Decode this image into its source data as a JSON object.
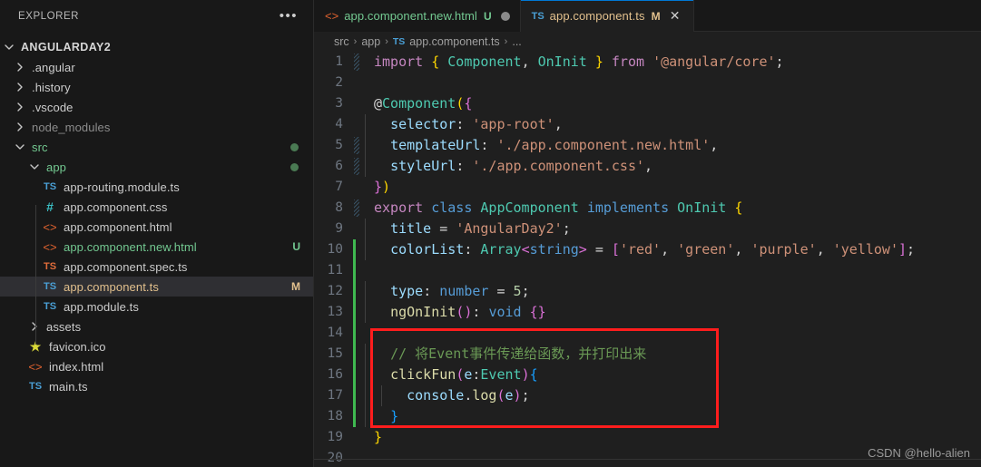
{
  "theme": {
    "sidebar_bg": "#181818",
    "editor_bg": "#1f1f1f",
    "accent": "#0078d4",
    "git_modified": "#3fb950",
    "annotation": "#ff1d1d",
    "selection_bg": "#2f2f33"
  },
  "sidebar": {
    "title": "EXPLORER",
    "more_icon": "•••",
    "tree": [
      {
        "label": "ANGULARDAY2",
        "type": "root-folder",
        "expanded": true,
        "depth": 0,
        "icon": "chevron-down-icon"
      },
      {
        "label": ".angular",
        "type": "folder",
        "expanded": false,
        "depth": 1,
        "icon": "chevron-right-icon"
      },
      {
        "label": ".history",
        "type": "folder",
        "expanded": false,
        "depth": 1,
        "icon": "chevron-right-icon"
      },
      {
        "label": ".vscode",
        "type": "folder",
        "expanded": false,
        "depth": 1,
        "icon": "chevron-right-icon"
      },
      {
        "label": "node_modules",
        "type": "folder",
        "expanded": false,
        "depth": 1,
        "icon": "chevron-right-icon",
        "dim": true
      },
      {
        "label": "src",
        "type": "folder",
        "expanded": true,
        "depth": 1,
        "icon": "chevron-down-icon",
        "color": "#73c991",
        "dot": true
      },
      {
        "label": "app",
        "type": "folder",
        "expanded": true,
        "depth": 2,
        "icon": "chevron-down-icon",
        "color": "#73c991",
        "dot": true
      },
      {
        "label": "app-routing.module.ts",
        "type": "file",
        "depth": 3,
        "icon": "ts-blue-icon"
      },
      {
        "label": "app.component.css",
        "type": "file",
        "depth": 3,
        "icon": "css-hash-icon"
      },
      {
        "label": "app.component.html",
        "type": "file",
        "depth": 3,
        "icon": "html-angle-icon"
      },
      {
        "label": "app.component.new.html",
        "type": "file",
        "depth": 3,
        "icon": "html-angle-icon",
        "color": "#73c991",
        "badge": "U",
        "badge_color": "#73c991"
      },
      {
        "label": "app.component.spec.ts",
        "type": "file",
        "depth": 3,
        "icon": "ts-orange-icon"
      },
      {
        "label": "app.component.ts",
        "type": "file",
        "depth": 3,
        "icon": "ts-blue-icon",
        "color": "#e2c08d",
        "badge": "M",
        "badge_color": "#e2c08d",
        "selected": true
      },
      {
        "label": "app.module.ts",
        "type": "file",
        "depth": 3,
        "icon": "ts-blue-icon"
      },
      {
        "label": "assets",
        "type": "folder",
        "expanded": false,
        "depth": 2,
        "icon": "chevron-right-icon"
      },
      {
        "label": "favicon.ico",
        "type": "file",
        "depth": 2,
        "icon": "star-icon"
      },
      {
        "label": "index.html",
        "type": "file",
        "depth": 2,
        "icon": "html-angle-icon"
      },
      {
        "label": "main.ts",
        "type": "file",
        "depth": 2,
        "icon": "ts-blue-icon"
      }
    ]
  },
  "tabs": [
    {
      "name": "app.component.new.html",
      "icon": "html-angle-icon",
      "status": "U",
      "status_color": "#73c991",
      "name_color": "#73c991",
      "active": false,
      "dirty": true
    },
    {
      "name": "app.component.ts",
      "icon": "ts-blue-icon",
      "status": "M",
      "status_color": "#e2c08d",
      "name_color": "#e2c08d",
      "active": true,
      "close_icon": "close-icon",
      "close_glyph": "✕"
    }
  ],
  "breadcrumb": {
    "items": [
      "src",
      "app",
      "app.component.ts",
      "..."
    ],
    "file_icon": "ts-blue-icon",
    "separator": "›"
  },
  "code": {
    "language": "typescript",
    "lines": [
      {
        "n": "1",
        "fold": true,
        "git": false
      },
      {
        "n": "2",
        "fold": false,
        "git": false
      },
      {
        "n": "3",
        "fold": false,
        "git": false
      },
      {
        "n": "4",
        "fold": false,
        "git": false
      },
      {
        "n": "5",
        "fold": true,
        "git": false
      },
      {
        "n": "6",
        "fold": true,
        "git": false
      },
      {
        "n": "7",
        "fold": false,
        "git": false
      },
      {
        "n": "8",
        "fold": true,
        "git": false
      },
      {
        "n": "9",
        "fold": false,
        "git": false
      },
      {
        "n": "10",
        "fold": false,
        "git": true
      },
      {
        "n": "11",
        "fold": false,
        "git": true
      },
      {
        "n": "12",
        "fold": false,
        "git": true
      },
      {
        "n": "13",
        "fold": false,
        "git": true
      },
      {
        "n": "14",
        "fold": false,
        "git": true
      },
      {
        "n": "15",
        "fold": false,
        "git": true
      },
      {
        "n": "16",
        "fold": false,
        "git": true
      },
      {
        "n": "17",
        "fold": false,
        "git": true
      },
      {
        "n": "18",
        "fold": false,
        "git": true
      },
      {
        "n": "19",
        "fold": false,
        "git": false
      },
      {
        "n": "20",
        "fold": false,
        "git": false
      }
    ],
    "text": [
      "import { Component, OnInit } from '@angular/core';",
      "",
      "@Component({",
      "  selector: 'app-root',",
      "  templateUrl: './app.component.new.html',",
      "  styleUrl: './app.component.css',",
      "})",
      "export class AppComponent implements OnInit {",
      "  title = 'AngularDay2';",
      "  colorList: Array<string> = ['red', 'green', 'purple', 'yellow'];",
      "",
      "  type: number = 5;",
      "  ngOnInit(): void {}",
      "",
      "  // 将Event事件传递给函数，并打印出来",
      "  clickFun(e:Event){",
      "    console.log(e);",
      "  }",
      "}",
      ""
    ]
  },
  "annotation": {
    "kind": "red-rectangle-highlight",
    "covers_lines": [
      "14",
      "15",
      "16",
      "17",
      "18"
    ],
    "color": "#ff1d1d"
  },
  "watermark": {
    "text": "CSDN @hello-alien"
  }
}
